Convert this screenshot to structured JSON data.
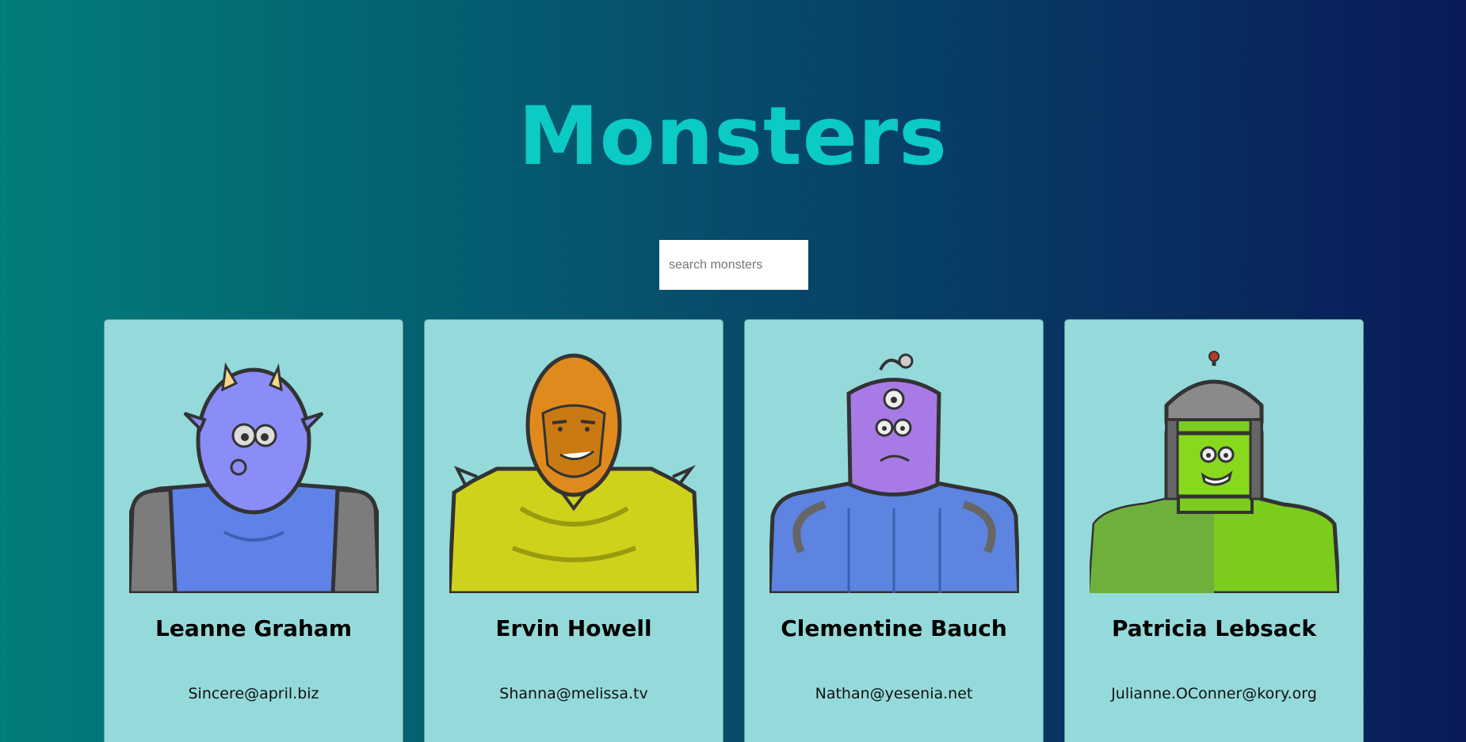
{
  "header": {
    "title": "Monsters"
  },
  "search": {
    "placeholder": "search monsters",
    "value": ""
  },
  "monsters": [
    {
      "name": "Leanne Graham",
      "email": "Sincere@april.biz",
      "skin": "#8a8cf7",
      "body": "#5f82e8",
      "icon": "horned-monster-icon"
    },
    {
      "name": "Ervin Howell",
      "email": "Shanna@melissa.tv",
      "skin": "#e08a1e",
      "body": "#cfd21a",
      "icon": "hooded-monster-icon"
    },
    {
      "name": "Clementine Bauch",
      "email": "Nathan@yesenia.net",
      "skin": "#a87ae6",
      "body": "#5c84e0",
      "icon": "three-eyed-monster-icon"
    },
    {
      "name": "Patricia Lebsack",
      "email": "Julianne.OConner@kory.org",
      "skin": "#88d81e",
      "body": "#7ccc1e",
      "icon": "robot-helmet-monster-icon"
    }
  ]
}
